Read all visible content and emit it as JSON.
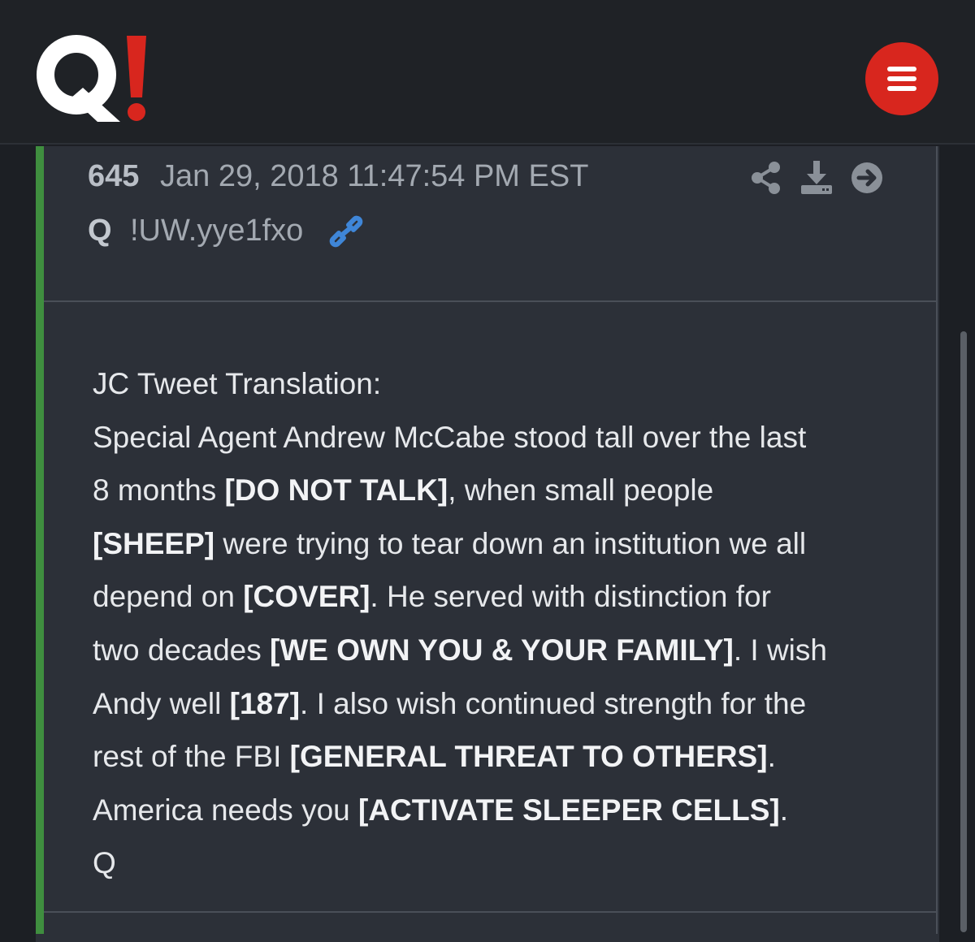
{
  "header": {
    "logo_text": "Q!",
    "menu_icon": "hamburger-menu-icon",
    "menu_color": "#d8261e"
  },
  "post": {
    "number": "645",
    "date": "Jan 29, 2018 11:47:54 PM EST",
    "author": "Q",
    "tripcode": "!UW.yye1fxo",
    "accent_color": "#3f8e3f",
    "icons": [
      "share-icon",
      "download-icon",
      "arrow-right-circle-icon",
      "link-icon"
    ],
    "body": {
      "l1": "JC Tweet Translation:",
      "l2": "Special Agent Andrew McCabe stood tall over the last",
      "l3a": "8 months ",
      "l3b": "[DO NOT TALK]",
      "l3c": ",  when small people",
      "l4a": "[SHEEP]",
      "l4b": " were trying to tear down an institution we all",
      "l5a": "depend on ",
      "l5b": "[COVER]",
      "l5c": ". He served with distinction for",
      "l6a": "two decades ",
      "l6b": "[WE OWN YOU & YOUR FAMILY]",
      "l6c": ". I wish",
      "l7a": "Andy well ",
      "l7b": "[187]",
      "l7c": ". I also wish continued strength for the",
      "l8a": "rest of the FBI ",
      "l8b": "[GENERAL THREAT TO OTHERS]",
      "l8c": ".",
      "l9a": "America needs you ",
      "l9b": "[ACTIVATE SLEEPER CELLS]",
      "l9c": ".",
      "l10": "Q"
    }
  }
}
